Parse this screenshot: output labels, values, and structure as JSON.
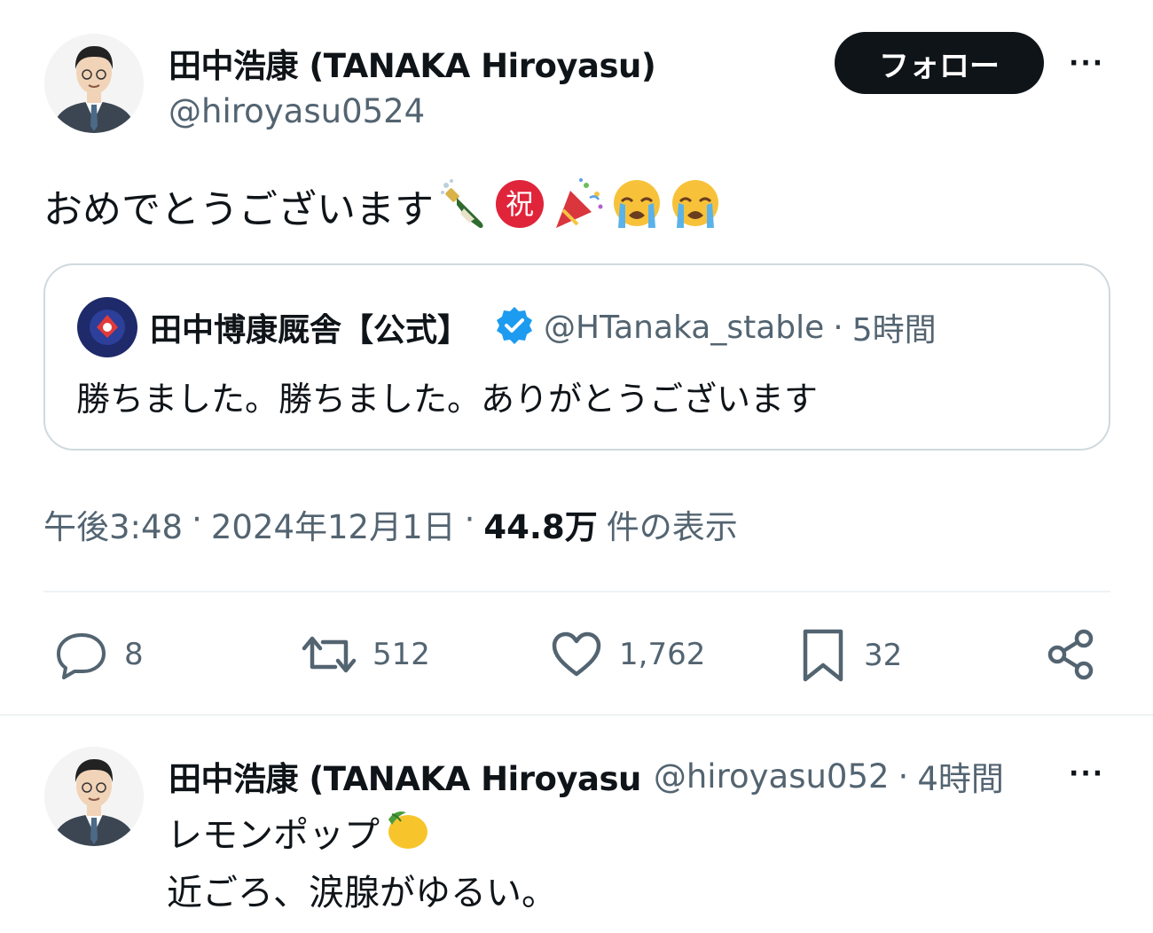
{
  "tweet": {
    "author_name": "田中浩康 (TANAKA Hiroyasu)",
    "author_handle": "@hiroyasu0524",
    "follow_label": "フォロー",
    "more_label": "···",
    "text": "おめでとうございます",
    "emojis": [
      "champagne-bottle",
      "congratulations-ideograph",
      "party-popper",
      "loudly-crying-face",
      "loudly-crying-face"
    ],
    "emoji_ideograph": "祝",
    "time": "午後3:48",
    "date": "2024年12月1日",
    "views_count": "44.8万",
    "views_label": "件の表示",
    "separator": "·"
  },
  "quote": {
    "name": "田中博康厩舎【公式】",
    "handle": "@HTanaka_stable",
    "time": "5時間",
    "separator": "·",
    "text": "勝ちました。勝ちました。ありがとうございます"
  },
  "actions": {
    "replies": "8",
    "retweets": "512",
    "likes": "1,762",
    "bookmarks": "32"
  },
  "reply": {
    "author_name": "田中浩康 (TANAKA Hiroyasu",
    "author_handle": "@hiroyasu052",
    "separator": "·",
    "time": "4時間",
    "more_label": "···",
    "line1": "レモンポップ",
    "line1_emoji": "lemon",
    "line2": "近ごろ、涙腺がゆるい。"
  },
  "colors": {
    "accent_dark": "#0f1419",
    "muted": "#536471",
    "border": "#cfd9de",
    "verified": "#1d9bf0"
  }
}
